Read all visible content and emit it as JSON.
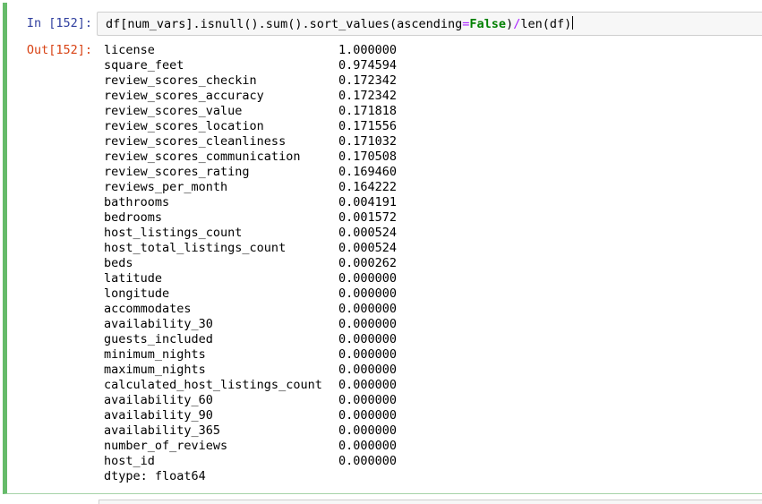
{
  "input_cell": {
    "prompt": "In [152]:",
    "code_parts": {
      "before_kw": "df[num_vars].isnull().sum().sort_values(ascending",
      "equals": "=",
      "keyword": "False",
      "after_kw": ")",
      "divide": "/",
      "tail": "len(df)"
    }
  },
  "output_cell": {
    "prompt": "Out[152]:",
    "rows": [
      {
        "name": "license",
        "value": "1.000000"
      },
      {
        "name": "square_feet",
        "value": "0.974594"
      },
      {
        "name": "review_scores_checkin",
        "value": "0.172342"
      },
      {
        "name": "review_scores_accuracy",
        "value": "0.172342"
      },
      {
        "name": "review_scores_value",
        "value": "0.171818"
      },
      {
        "name": "review_scores_location",
        "value": "0.171556"
      },
      {
        "name": "review_scores_cleanliness",
        "value": "0.171032"
      },
      {
        "name": "review_scores_communication",
        "value": "0.170508"
      },
      {
        "name": "review_scores_rating",
        "value": "0.169460"
      },
      {
        "name": "reviews_per_month",
        "value": "0.164222"
      },
      {
        "name": "bathrooms",
        "value": "0.004191"
      },
      {
        "name": "bedrooms",
        "value": "0.001572"
      },
      {
        "name": "host_listings_count",
        "value": "0.000524"
      },
      {
        "name": "host_total_listings_count",
        "value": "0.000524"
      },
      {
        "name": "beds",
        "value": "0.000262"
      },
      {
        "name": "latitude",
        "value": "0.000000"
      },
      {
        "name": "longitude",
        "value": "0.000000"
      },
      {
        "name": "accommodates",
        "value": "0.000000"
      },
      {
        "name": "availability_30",
        "value": "0.000000"
      },
      {
        "name": "guests_included",
        "value": "0.000000"
      },
      {
        "name": "minimum_nights",
        "value": "0.000000"
      },
      {
        "name": "maximum_nights",
        "value": "0.000000"
      },
      {
        "name": "calculated_host_listings_count",
        "value": "0.000000"
      },
      {
        "name": "availability_60",
        "value": "0.000000"
      },
      {
        "name": "availability_90",
        "value": "0.000000"
      },
      {
        "name": "availability_365",
        "value": "0.000000"
      },
      {
        "name": "number_of_reviews",
        "value": "0.000000"
      },
      {
        "name": "host_id",
        "value": "0.000000"
      }
    ],
    "dtype": "dtype: float64"
  },
  "colors": {
    "in_prompt": "#303f9f",
    "out_prompt": "#d84315",
    "selected_cell_border": "#66bb6a",
    "keyword": "#008000",
    "operator": "#aa22ff"
  }
}
